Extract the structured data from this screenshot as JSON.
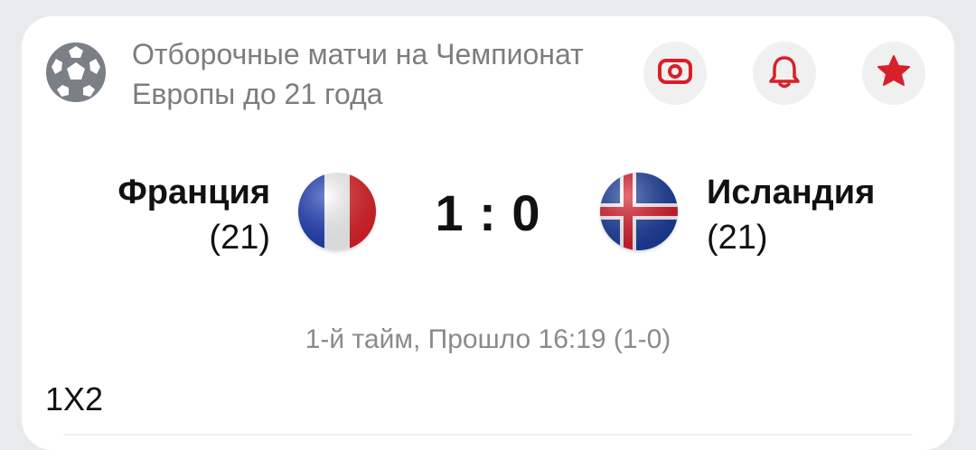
{
  "header": {
    "league": "Отборочные матчи на Чемпионат Европы до 21 года",
    "league_icon": "soccer-ball-icon",
    "buttons": [
      {
        "name": "live-stream",
        "icon": "stream-icon"
      },
      {
        "name": "notifications",
        "icon": "bell-icon"
      },
      {
        "name": "favorite",
        "icon": "star-icon"
      }
    ]
  },
  "match": {
    "home": {
      "name": "Франция",
      "sub": "(21)",
      "flag": "france-flag-icon"
    },
    "away": {
      "name": "Исландия",
      "sub": "(21)",
      "flag": "iceland-flag-icon"
    },
    "score": "1 : 0",
    "status": "1-й тайм, Прошло 16:19 (1-0)"
  },
  "market": {
    "title": "1X2"
  },
  "colors": {
    "accent": "#d8202a",
    "button_bg": "#f0f0f0",
    "muted_text": "#7d7d7d",
    "page_bg": "#e9eaeb"
  }
}
